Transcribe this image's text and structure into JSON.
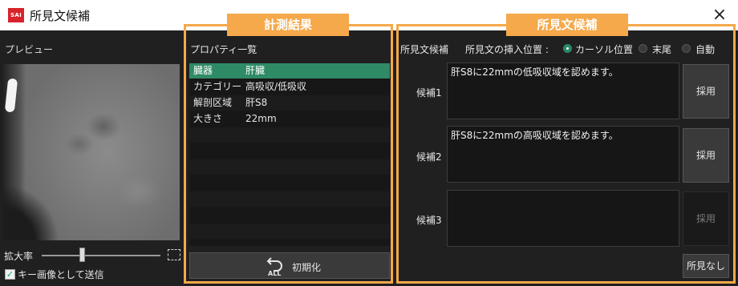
{
  "window": {
    "logo_text": "SAI",
    "title": "所見文候補",
    "close_glyph": "×"
  },
  "preview": {
    "label": "プレビュー",
    "zoom_label": "拡大率",
    "zoom_level": 0.33,
    "send_checkbox_checked": true,
    "send_label": "キー画像として送信"
  },
  "measurement": {
    "tag": "計測結果",
    "list_title": "プロパティ一覧",
    "rows": [
      {
        "key": "臓器",
        "value": "肝臓",
        "selected": true
      },
      {
        "key": "カテゴリー",
        "value": "高吸収/低吸収"
      },
      {
        "key": "解剖区域",
        "value": "肝S8"
      },
      {
        "key": "大きさ",
        "value": "22mm"
      }
    ],
    "reset_icon_text": "ALL",
    "reset_label": "初期化"
  },
  "candidates": {
    "tag": "所見文候補",
    "header": "所見文候補",
    "insert_label": "所見文の挿入位置 :",
    "insert_options": [
      {
        "label": "カーソル位置",
        "selected": true
      },
      {
        "label": "末尾",
        "selected": false
      },
      {
        "label": "自動",
        "selected": false
      }
    ],
    "items": [
      {
        "label": "候補1",
        "text": "肝S8に22mmの低吸収域を認めます。",
        "button": "採用",
        "enabled": true
      },
      {
        "label": "候補2",
        "text": "肝S8に22mmの高吸収域を認めます。",
        "button": "採用",
        "enabled": true
      },
      {
        "label": "候補3",
        "text": "",
        "button": "採用",
        "enabled": false
      }
    ],
    "none_button": "所見なし"
  },
  "colors": {
    "accent_frame": "#f5a94a",
    "selected_row": "#2e8b66",
    "logo": "#d8232a"
  }
}
